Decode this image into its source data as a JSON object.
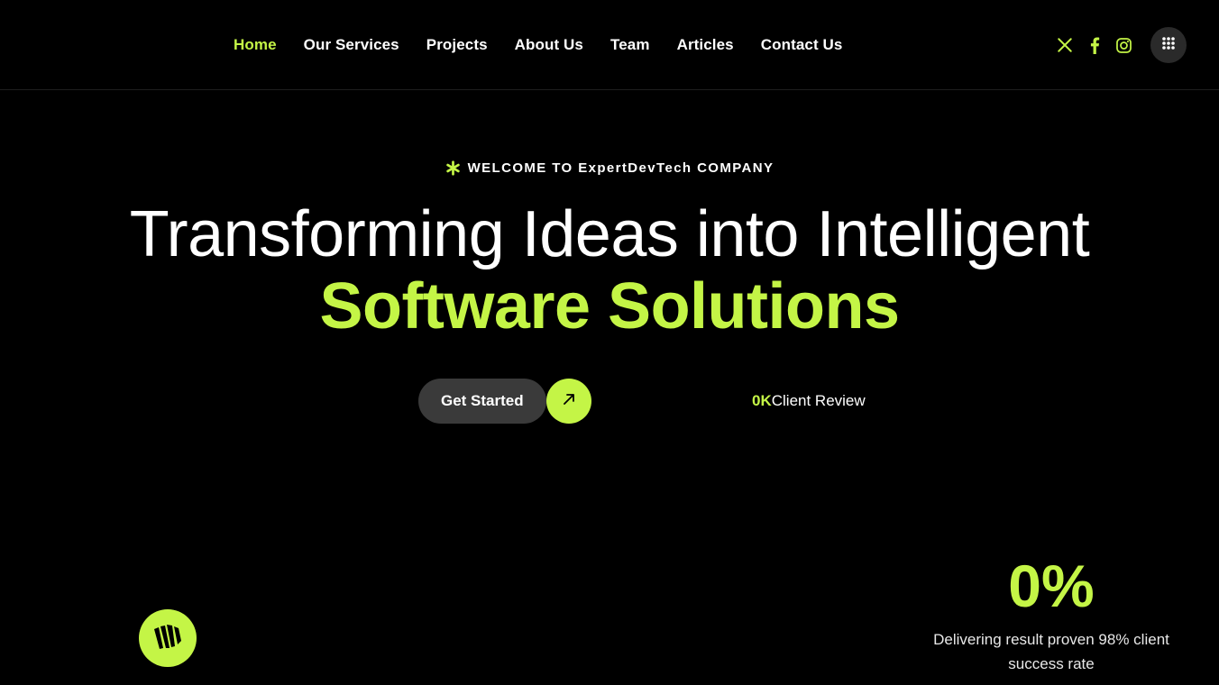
{
  "header": {
    "nav": [
      {
        "label": "Home",
        "active": true
      },
      {
        "label": "Our Services",
        "active": false
      },
      {
        "label": "Projects",
        "active": false
      },
      {
        "label": "About Us",
        "active": false
      },
      {
        "label": "Team",
        "active": false
      },
      {
        "label": "Articles",
        "active": false
      },
      {
        "label": "Contact Us",
        "active": false
      }
    ],
    "social_icons": [
      "x-icon",
      "facebook-icon",
      "instagram-icon"
    ],
    "menu_icon": "grid-dots-icon"
  },
  "hero": {
    "welcome": "WELCOME TO ExpertDevTech COMPANY",
    "title_line1": "Transforming Ideas into Intelligent",
    "title_line2": "Software Solutions",
    "cta_label": "Get Started",
    "review_count": "0K",
    "review_label": "Client Review"
  },
  "stat": {
    "value": "0%",
    "description": "Delivering result proven 98% client success rate"
  },
  "colors": {
    "background": "#000000",
    "accent": "#c4f546",
    "button_dark": "#3a3a3a"
  }
}
